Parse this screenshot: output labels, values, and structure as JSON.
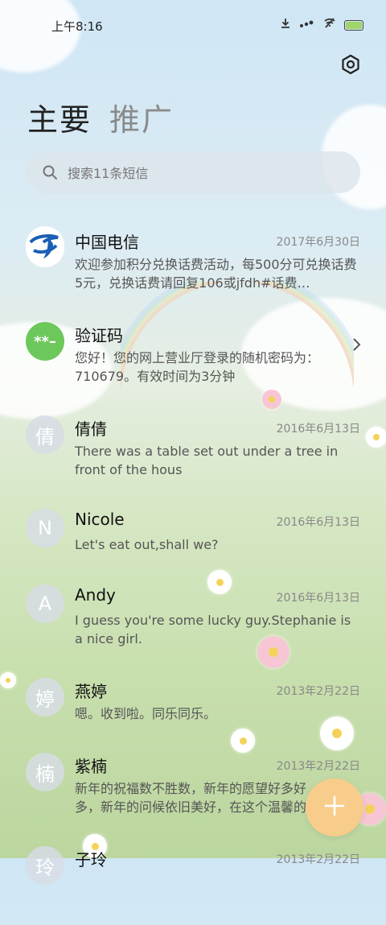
{
  "status_bar": {
    "time": "上午8:16",
    "icons": [
      "download-icon",
      "signal-icon",
      "wifi-off-icon",
      "battery-icon"
    ]
  },
  "header": {
    "settings_icon": "settings-icon"
  },
  "tabs": [
    {
      "label": "主要",
      "active": true
    },
    {
      "label": "推广",
      "active": false
    }
  ],
  "search": {
    "placeholder": "搜索11条短信"
  },
  "conversations": [
    {
      "name": "中国电信",
      "date": "2017年6月30日",
      "preview": "欢迎参加积分兑换话费活动，每500分可兑换话费5元，兑换话费请回复106或jfdh#话费…",
      "avatar_text": "",
      "avatar_icon": "china-telecom-logo"
    },
    {
      "name": "验证码",
      "date": "",
      "preview": "您好！您的网上营业厅登录的随机密码为：710679。有效时间为3分钟",
      "avatar_text": "**–",
      "has_chevron": true
    },
    {
      "name": "倩倩",
      "date": "2016年6月13日",
      "preview": "There was a table set out under a tree in front of the hous",
      "avatar_text": "倩"
    },
    {
      "name": "Nicole",
      "date": "2016年6月13日",
      "preview": "Let's eat out,shall we?",
      "avatar_text": "N"
    },
    {
      "name": "Andy",
      "date": "2016年6月13日",
      "preview": "I guess you're some lucky guy.Stephanie is a nice girl.",
      "avatar_text": "A"
    },
    {
      "name": "燕婷",
      "date": "2013年2月22日",
      "preview": "嗯。收到啦。同乐同乐。",
      "avatar_text": "婷"
    },
    {
      "name": "紫楠",
      "date": "2013年2月22日",
      "preview": "新年的祝福数不胜数，新年的愿望好多好多，新年的问候依旧美好，在这个温馨的时刻",
      "avatar_text": "楠"
    },
    {
      "name": "子玲",
      "date": "2013年2月22日",
      "preview": "",
      "avatar_text": "玲"
    }
  ],
  "fab": {
    "icon": "plus-icon"
  },
  "colors": {
    "verify_avatar": "#6cc85a",
    "telecom_blue": "#1a5fb4",
    "fab": "#f8cc8a"
  }
}
